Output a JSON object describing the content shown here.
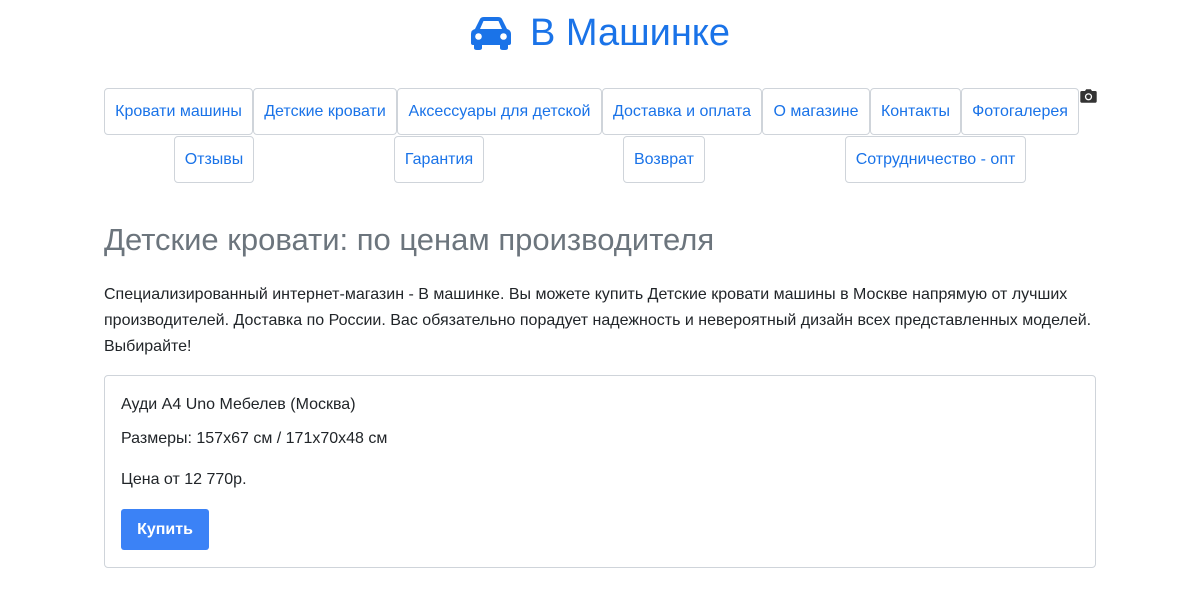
{
  "header": {
    "icon": "car-icon",
    "title": "В Машинке"
  },
  "nav": {
    "row1": [
      {
        "label": "Кровати машины"
      },
      {
        "label": "Детские кровати"
      },
      {
        "label": "Аксессуары для детской"
      },
      {
        "label": "Доставка и оплата"
      },
      {
        "label": "О магазине"
      },
      {
        "label": "Контакты"
      },
      {
        "label": "Фотогалерея",
        "icon": "camera-icon"
      }
    ],
    "row2": [
      {
        "label": "Отзывы"
      },
      {
        "label": "Гарантия"
      },
      {
        "label": "Возврат"
      },
      {
        "label": "Сотрудничество - опт"
      }
    ]
  },
  "main": {
    "title": "Детские кровати: по ценам производителя",
    "intro": "Специализированный интернет-магазин - В машинке. Вы можете купить Детские кровати машины в Москве напрямую от лучших производителей. Доставка по России. Вас обязательно порадует надежность и невероятный дизайн всех представленных моделей. Выбирайте!"
  },
  "product": {
    "name": "Ауди А4 Uno Мебелев (Москва)",
    "sizes": "Размеры: 157x67 см / 171x70x48 см",
    "price": "Цена от 12 770р.",
    "buy_label": "Купить"
  },
  "colors": {
    "brand": "#1a73e8",
    "button": "#3b82f6",
    "title_gray": "#6c757d"
  }
}
